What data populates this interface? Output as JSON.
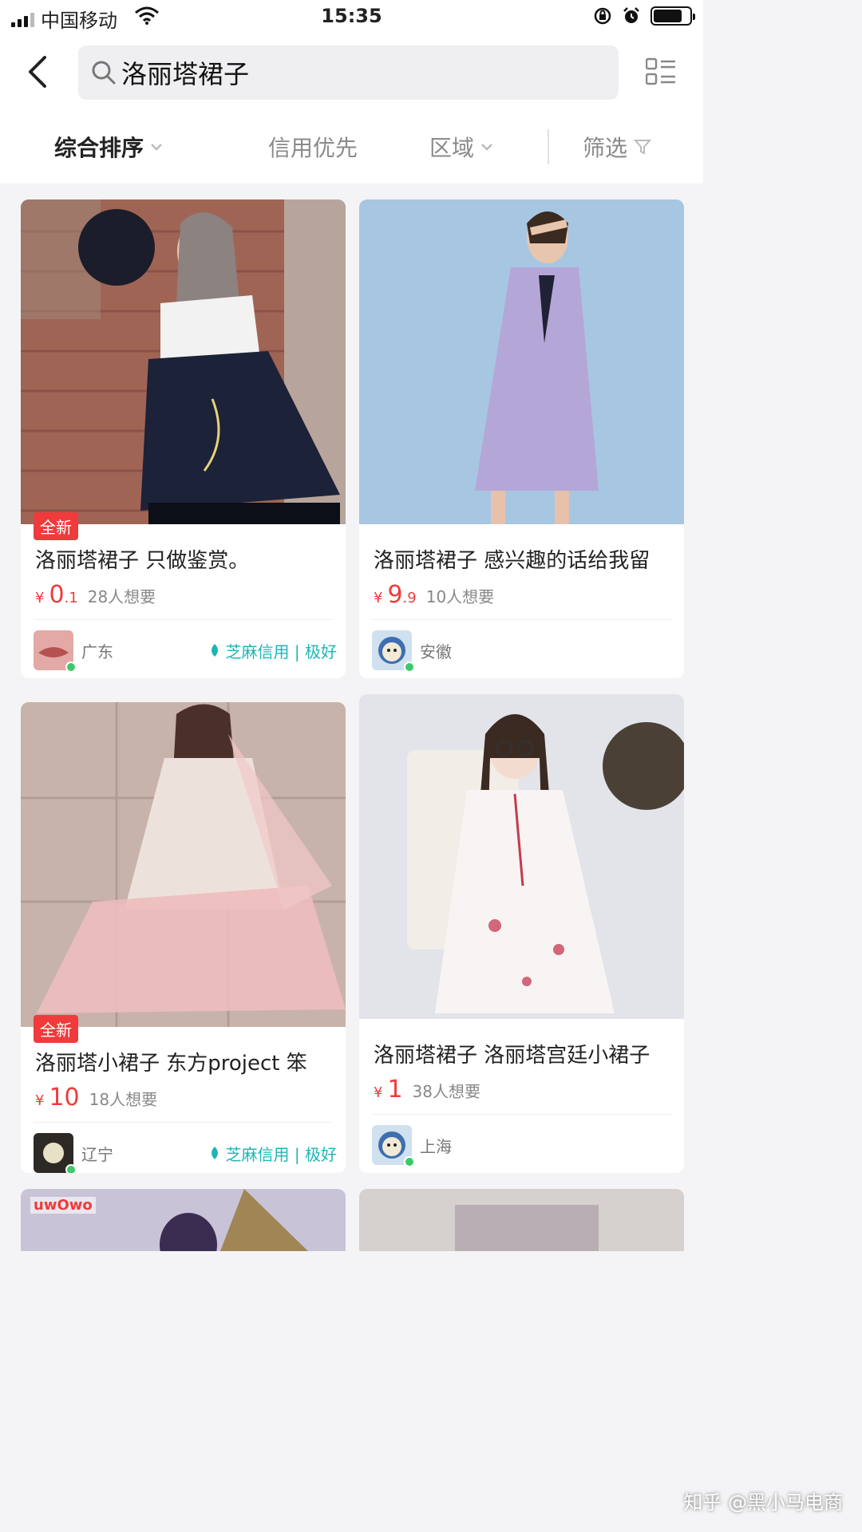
{
  "status": {
    "carrier": "中国移动",
    "time": "15:35",
    "battery_level": 0.8
  },
  "search": {
    "query": "洛丽塔裙子"
  },
  "filters": {
    "sort_label": "综合排序",
    "credit_label": "信用优先",
    "region_label": "区域",
    "filter_label": "筛选"
  },
  "items": [
    {
      "tag": "全新",
      "title": "洛丽塔裙子 只做鉴赏。",
      "currency": "¥",
      "price_int": "0",
      "price_dec": ".1",
      "want": "28人想要",
      "region": "广东",
      "credit": "芝麻信用 | 极好"
    },
    {
      "tag": "",
      "title": "洛丽塔裙子 感兴趣的话给我留",
      "currency": "¥",
      "price_int": "9",
      "price_dec": ".9",
      "want": "10人想要",
      "region": "安徽",
      "credit": ""
    },
    {
      "tag": "全新",
      "title": "洛丽塔小裙子 东方project  笨",
      "currency": "¥",
      "price_int": "10",
      "price_dec": "",
      "want": "18人想要",
      "region": "辽宁",
      "credit": "芝麻信用 | 极好"
    },
    {
      "tag": "",
      "title": "洛丽塔裙子 洛丽塔宫廷小裙子",
      "currency": "¥",
      "price_int": "1",
      "price_dec": "",
      "want": "38人想要",
      "region": "上海",
      "credit": ""
    }
  ],
  "bottom_banner_text": "uwOwo",
  "watermark": "知乎 @黑小马电商",
  "colors": {
    "accent_red": "#ef3b3b",
    "credit_teal": "#1fb5b5",
    "online_green": "#3dc96a"
  }
}
